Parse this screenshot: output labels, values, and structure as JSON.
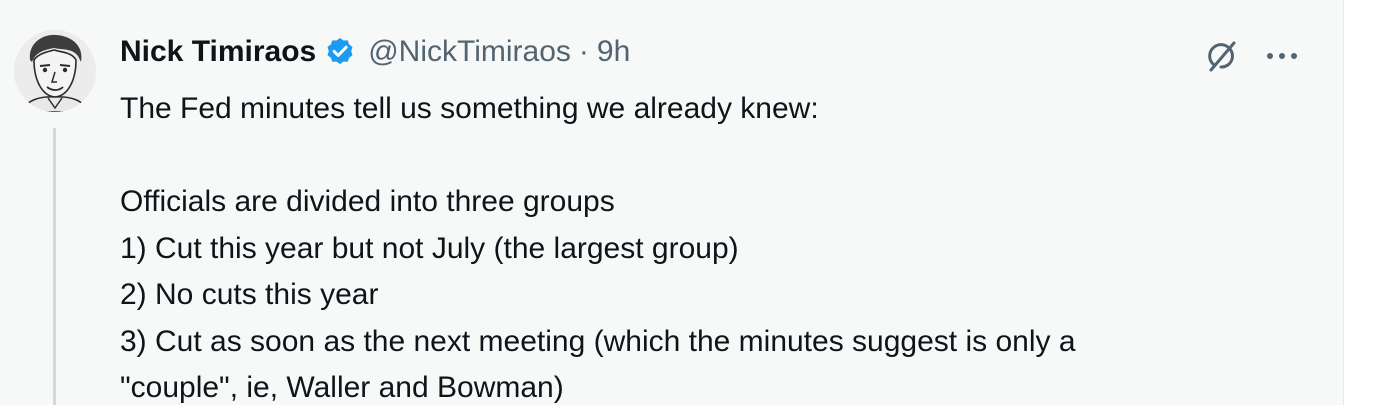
{
  "tweet": {
    "author_name": "Nick Timiraos",
    "handle": "@NickTimiraos",
    "separator": "·",
    "time": "9h",
    "verified": true,
    "icons": {
      "verified": "verified-badge-icon",
      "grok": "grok-icon",
      "more": "more-icon"
    },
    "colors": {
      "verified": "#1d9bf0",
      "text": "#0f1419",
      "secondary": "#536471"
    },
    "text": {
      "intro": "The Fed minutes tell us something we already knew:",
      "groups_lead": "Officials are divided into three groups",
      "item_1": "1) Cut this year but not July (the largest group)",
      "item_2": "2) No cuts this year",
      "item_3_line_1": "3) Cut as soon as the next meeting (which the minutes suggest is only a",
      "item_3_line_2": "\"couple\", ie, Waller and Bowman)"
    }
  }
}
